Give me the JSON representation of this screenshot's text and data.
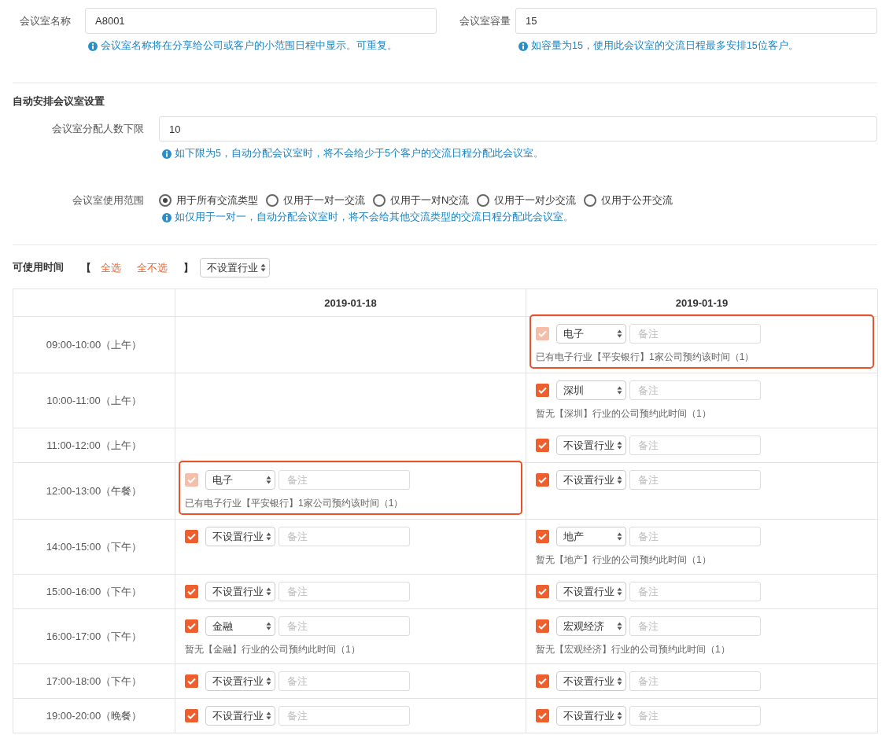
{
  "room_fields": [
    {
      "label": "会议室名称",
      "value": "A8001",
      "help": "会议室名称将在分享给公司或客户的小范围日程中显示。可重复。"
    },
    {
      "label": "会议室容量",
      "value": "15",
      "help": "如容量为15，使用此会议室的交流日程最多安排15位客户。"
    }
  ],
  "auto_section": {
    "title": "自动安排会议室设置",
    "min_field": {
      "label": "会议室分配人数下限",
      "value": "10",
      "help": "如下限为5，自动分配会议室时，将不会给少于5个客户的交流日程分配此会议室。"
    },
    "scope": {
      "label": "会议室使用范围",
      "options": [
        {
          "label": "用于所有交流类型",
          "selected": true
        },
        {
          "label": "仅用于一对一交流",
          "selected": false
        },
        {
          "label": "仅用于一对N交流",
          "selected": false
        },
        {
          "label": "仅用于一对少交流",
          "selected": false
        },
        {
          "label": "仅用于公开交流",
          "selected": false
        }
      ],
      "help": "如仅用于一对一，自动分配会议室时，将不会给其他交流类型的交流日程分配此会议室。"
    }
  },
  "availability": {
    "label": "可使用时间",
    "bracket_open": "【",
    "links": [
      "全选",
      "全不选"
    ],
    "bracket_close": "】",
    "industry_select": "不设置行业"
  },
  "table": {
    "columns": [
      {
        "label": "2019-01-18"
      },
      {
        "label": "2019-01-19"
      }
    ],
    "rows": [
      {
        "time": "09:00-10:00（上午）",
        "cells": [
          {
            "kind": "empty"
          },
          {
            "kind": "slot",
            "checked": true,
            "disabled": true,
            "highlighted": true,
            "industry": "电子",
            "placeholder": "备注",
            "message": "已有电子行业【平安银行】1家公司预约该时间（1）"
          }
        ]
      },
      {
        "time": "10:00-11:00（上午）",
        "cells": [
          {
            "kind": "empty"
          },
          {
            "kind": "slot",
            "checked": true,
            "disabled": false,
            "highlighted": false,
            "industry": "深圳",
            "placeholder": "备注",
            "message": "暂无【深圳】行业的公司预约此时间（1）"
          }
        ]
      },
      {
        "time": "11:00-12:00（上午）",
        "cells": [
          {
            "kind": "empty"
          },
          {
            "kind": "slot",
            "checked": true,
            "disabled": false,
            "highlighted": false,
            "industry": "不设置行业",
            "placeholder": "备注"
          }
        ]
      },
      {
        "time": "12:00-13:00（午餐）",
        "cells": [
          {
            "kind": "slot",
            "checked": true,
            "disabled": true,
            "highlighted": true,
            "industry": "电子",
            "placeholder": "备注",
            "message": "已有电子行业【平安银行】1家公司预约该时间（1）"
          },
          {
            "kind": "slot",
            "checked": true,
            "disabled": false,
            "highlighted": false,
            "industry": "不设置行业",
            "placeholder": "备注"
          }
        ]
      },
      {
        "time": "14:00-15:00（下午）",
        "cells": [
          {
            "kind": "slot",
            "checked": true,
            "disabled": false,
            "highlighted": false,
            "industry": "不设置行业",
            "placeholder": "备注"
          },
          {
            "kind": "slot",
            "checked": true,
            "disabled": false,
            "highlighted": false,
            "industry": "地产",
            "placeholder": "备注",
            "message": "暂无【地产】行业的公司预约此时间（1）"
          }
        ]
      },
      {
        "time": "15:00-16:00（下午）",
        "cells": [
          {
            "kind": "slot",
            "checked": true,
            "disabled": false,
            "highlighted": false,
            "industry": "不设置行业",
            "placeholder": "备注"
          },
          {
            "kind": "slot",
            "checked": true,
            "disabled": false,
            "highlighted": false,
            "industry": "不设置行业",
            "placeholder": "备注"
          }
        ]
      },
      {
        "time": "16:00-17:00（下午）",
        "cells": [
          {
            "kind": "slot",
            "checked": true,
            "disabled": false,
            "highlighted": false,
            "industry": "金融",
            "placeholder": "备注",
            "message": "暂无【金融】行业的公司预约此时间（1）"
          },
          {
            "kind": "slot",
            "checked": true,
            "disabled": false,
            "highlighted": false,
            "industry": "宏观经济",
            "placeholder": "备注",
            "message": "暂无【宏观经济】行业的公司预约此时间（1）"
          }
        ]
      },
      {
        "time": "17:00-18:00（下午）",
        "cells": [
          {
            "kind": "slot",
            "checked": true,
            "disabled": false,
            "highlighted": false,
            "industry": "不设置行业",
            "placeholder": "备注"
          },
          {
            "kind": "slot",
            "checked": true,
            "disabled": false,
            "highlighted": false,
            "industry": "不设置行业",
            "placeholder": "备注"
          }
        ]
      },
      {
        "time": "19:00-20:00（晚餐）",
        "cells": [
          {
            "kind": "slot",
            "checked": true,
            "disabled": false,
            "highlighted": false,
            "industry": "不设置行业",
            "placeholder": "备注"
          },
          {
            "kind": "slot",
            "checked": true,
            "disabled": false,
            "highlighted": false,
            "industry": "不设置行业",
            "placeholder": "备注"
          }
        ]
      }
    ]
  }
}
